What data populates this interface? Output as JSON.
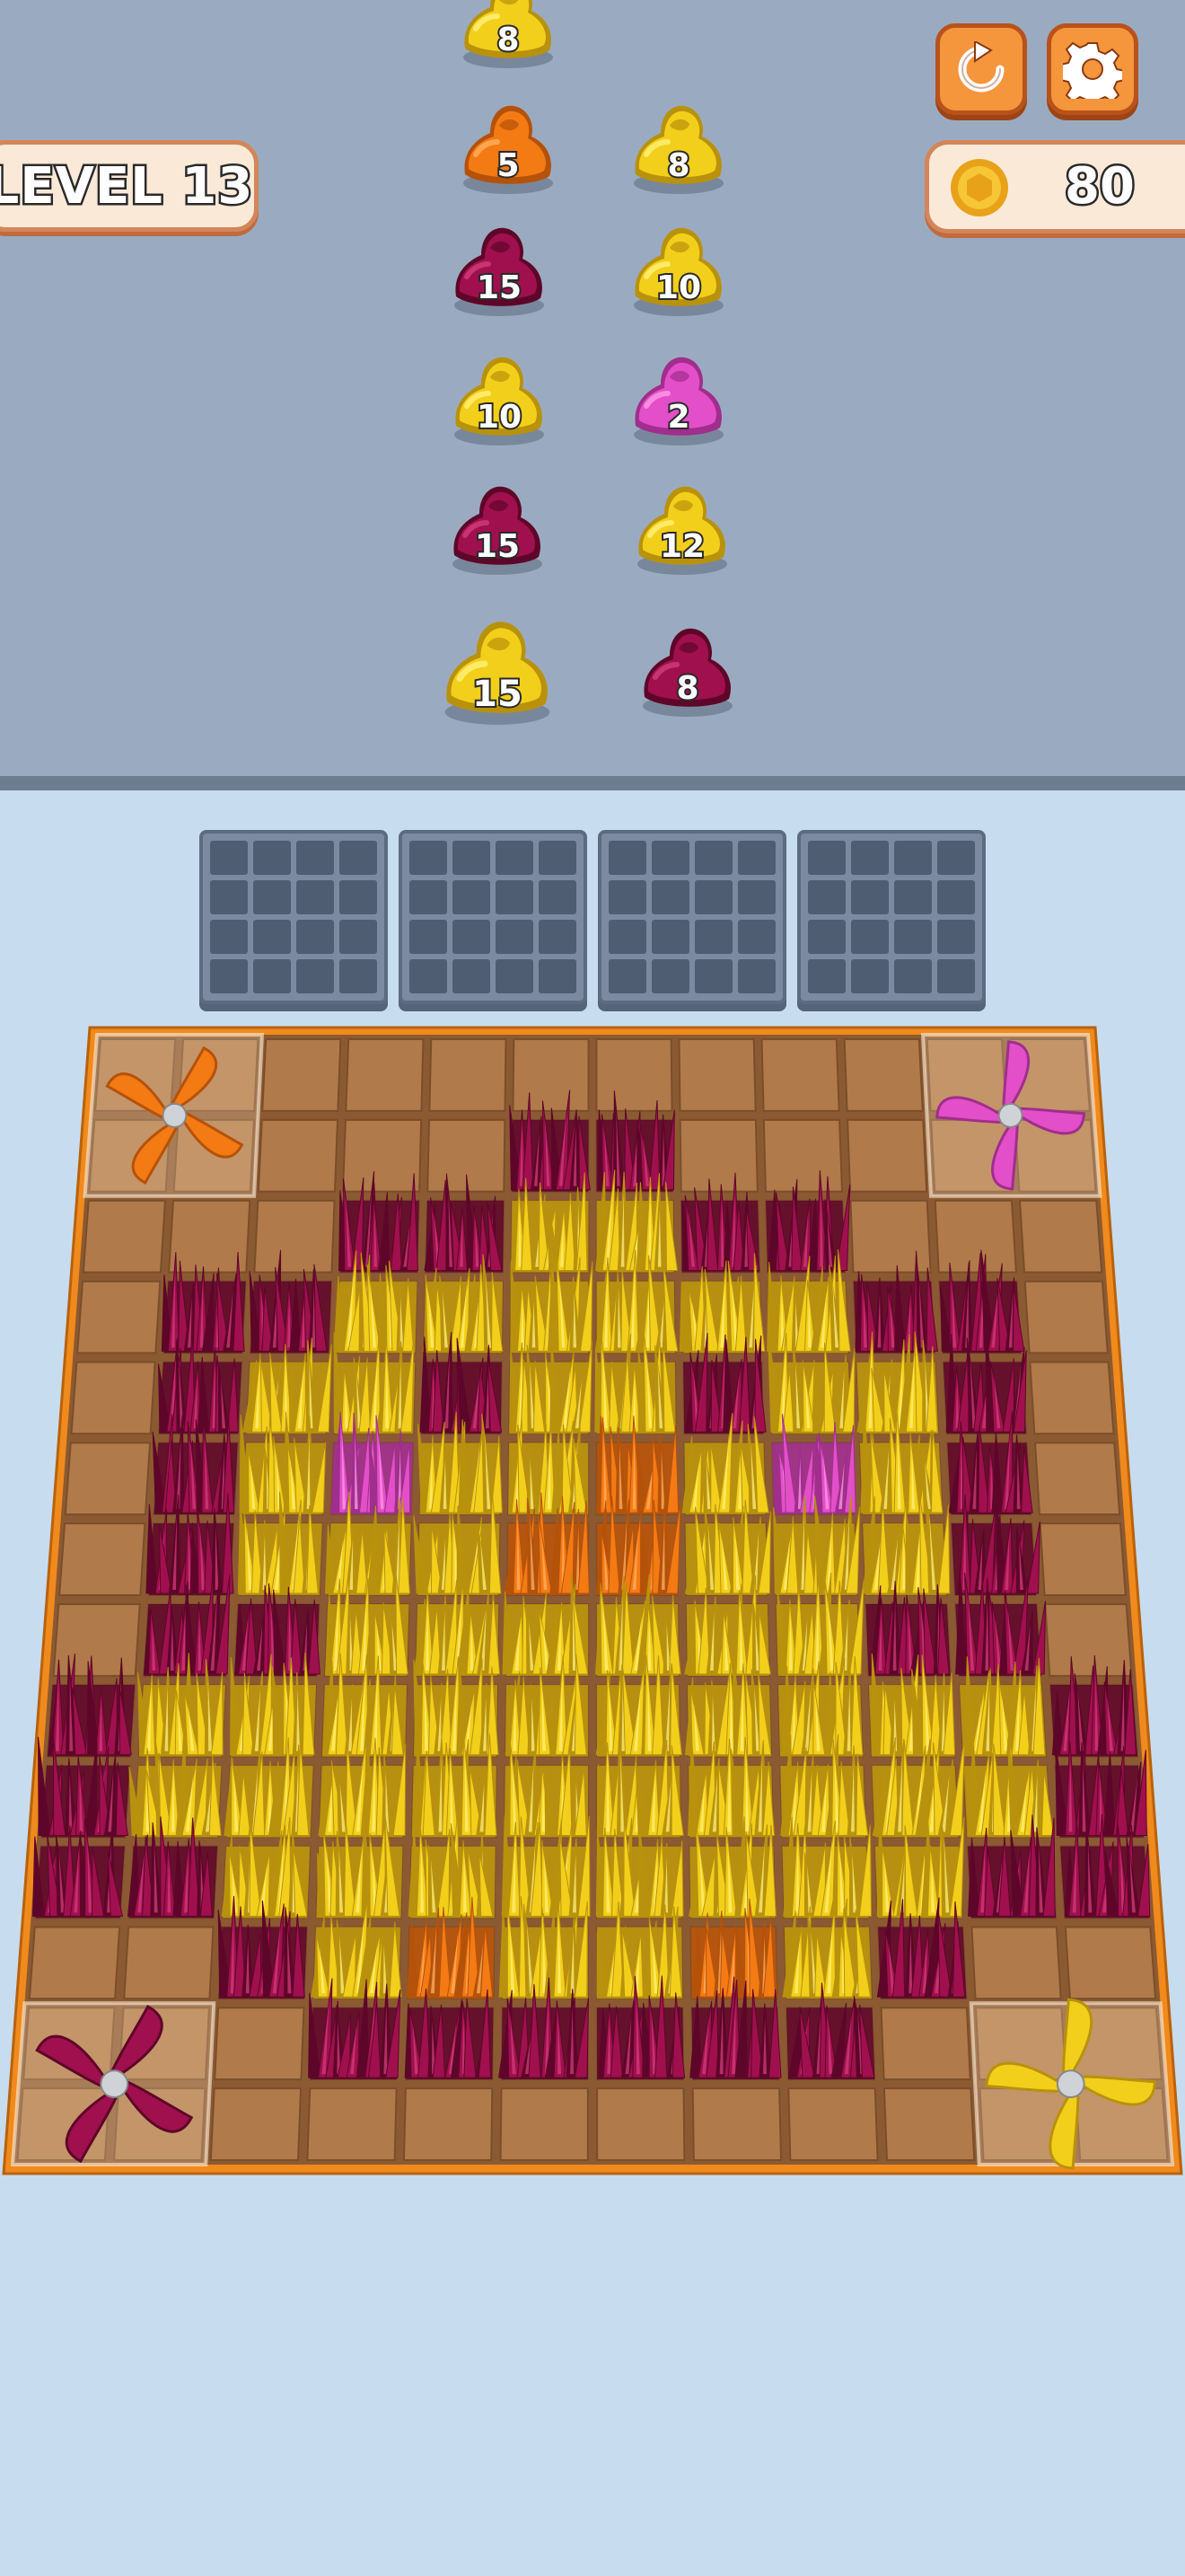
{
  "header": {
    "level_label": "LEVEL 13",
    "coins": "80",
    "restart_icon": "restart-icon",
    "settings_icon": "gear-icon",
    "coin_icon": "coin-icon"
  },
  "colors": {
    "yellow": "#f2cf1a",
    "orange": "#f47a14",
    "pink": "#e24fc8",
    "magenta": "#a0104e",
    "board_orange": "#f08a1c",
    "tile_brown": "#b07a4a"
  },
  "piles": [
    {
      "color": "yellow",
      "count": "8"
    },
    {
      "color": "orange",
      "count": "5"
    },
    {
      "color": "yellow",
      "count": "8"
    },
    {
      "color": "magenta",
      "count": "15"
    },
    {
      "color": "yellow",
      "count": "10"
    },
    {
      "color": "yellow",
      "count": "10"
    },
    {
      "color": "pink",
      "count": "2"
    },
    {
      "color": "magenta",
      "count": "15"
    },
    {
      "color": "yellow",
      "count": "12"
    },
    {
      "color": "yellow",
      "count": "15"
    },
    {
      "color": "magenta",
      "count": "8"
    }
  ],
  "trays": [
    {
      "name": "tray-1",
      "slots": 16
    },
    {
      "name": "tray-2",
      "slots": 16
    },
    {
      "name": "tray-3",
      "slots": 16
    },
    {
      "name": "tray-4",
      "slots": 16
    }
  ],
  "board": {
    "columns": 12,
    "rows": 14,
    "legend": {
      ".": "empty",
      "Y": "yellow",
      "M": "magenta",
      "O": "orange",
      "P": "pink"
    },
    "grid": [
      "............",
      ".....MM.....",
      "...MMYYMM...",
      ".MMYYYYYYMM.",
      ".MYYMYYMYYM.",
      ".MYPYYOYPYM.",
      ".MYYYOOYYYM.",
      ".MMYYYYYYMM.",
      "MYYYYYYYYYYM",
      "MYYYYYYYYYYM",
      "MMYYYYYYYYMM",
      "..MYOYYOYM..",
      "...MMMMMM...",
      "............"
    ],
    "blades": [
      {
        "corner": "top-left",
        "color": "orange"
      },
      {
        "corner": "top-right",
        "color": "pink"
      },
      {
        "corner": "bottom-left",
        "color": "magenta"
      },
      {
        "corner": "bottom-right",
        "color": "yellow"
      }
    ]
  }
}
